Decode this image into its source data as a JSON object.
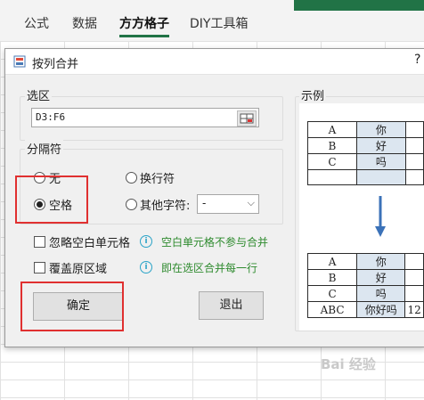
{
  "ribbon": {
    "tabs": [
      "公式",
      "数据",
      "方方格子",
      "DIY工具箱"
    ],
    "active_tab": "方方格子"
  },
  "dialog": {
    "title": "按列合并",
    "help": "?",
    "selection": {
      "label": "选区",
      "value": "D3:F6"
    },
    "separator": {
      "label": "分隔符",
      "options": {
        "none": "无",
        "newline": "换行符",
        "space": "空格",
        "other": "其他字符:"
      },
      "selected": "space",
      "other_value": "-"
    },
    "checks": [
      {
        "label": "忽略空白单元格",
        "checked": false,
        "hint": "空白单元格不参与合并"
      },
      {
        "label": "覆盖原区域",
        "checked": false,
        "hint": "即在选区合并每一行"
      }
    ],
    "buttons": {
      "ok": "确定",
      "exit": "退出"
    },
    "example": {
      "label": "示例",
      "before": [
        [
          "A",
          "你"
        ],
        [
          "B",
          "好"
        ],
        [
          "C",
          "吗"
        ],
        [
          "",
          ""
        ]
      ],
      "after": [
        [
          "A",
          "你",
          ""
        ],
        [
          "B",
          "好",
          ""
        ],
        [
          "C",
          "吗",
          ""
        ],
        [
          "ABC",
          "你好吗",
          "12"
        ]
      ]
    }
  },
  "watermark": "Bai 经验",
  "colors": {
    "accent": "#217346",
    "highlight": "#e03030",
    "hint": "#2d8a2d",
    "info": "#2aa3c7"
  }
}
